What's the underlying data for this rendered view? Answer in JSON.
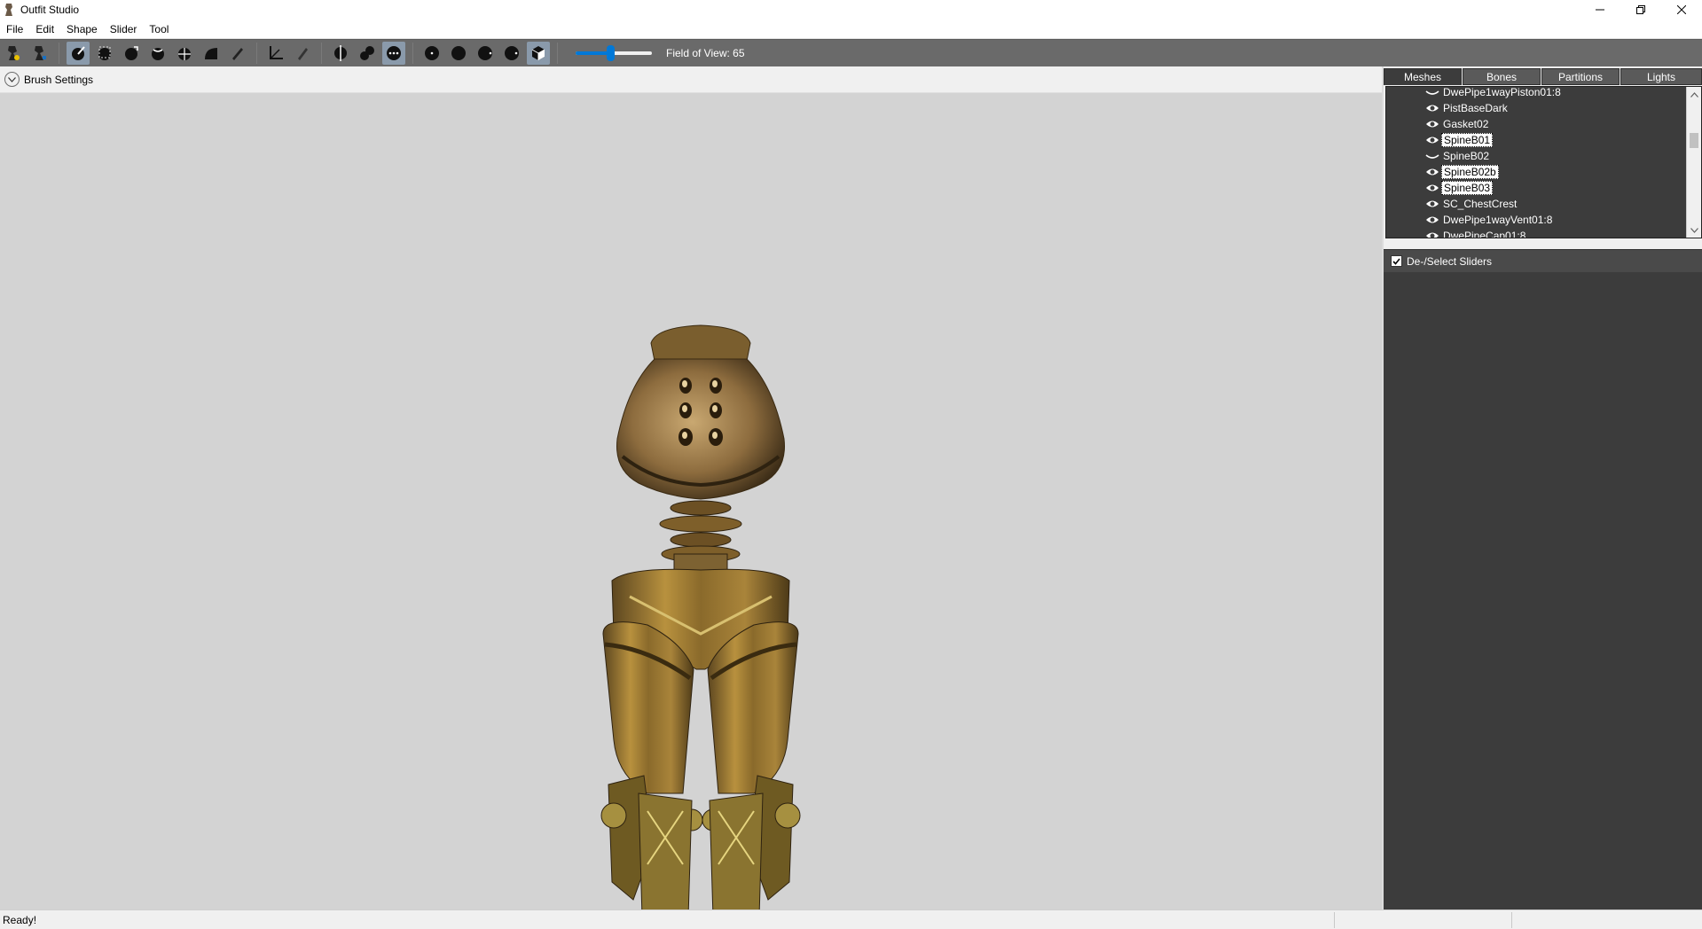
{
  "window": {
    "title": "Outfit Studio"
  },
  "menu": [
    "File",
    "Edit",
    "Shape",
    "Slider",
    "Tool"
  ],
  "toolbar": {
    "fov_label": "Field of View: 65",
    "fov_value": 65
  },
  "brush_settings": {
    "label": "Brush Settings"
  },
  "tabs": [
    {
      "label": "Meshes",
      "selected": true
    },
    {
      "label": "Bones",
      "selected": false
    },
    {
      "label": "Partitions",
      "selected": false
    },
    {
      "label": "Lights",
      "selected": false
    }
  ],
  "meshes": [
    {
      "name": "DwePipe1wayPiston01:8",
      "visible": false,
      "selected": false
    },
    {
      "name": "PistBaseDark",
      "visible": true,
      "selected": false
    },
    {
      "name": "Gasket02",
      "visible": true,
      "selected": false
    },
    {
      "name": "SpineB01",
      "visible": true,
      "selected": true
    },
    {
      "name": "SpineB02",
      "visible": false,
      "selected": false
    },
    {
      "name": "SpineB02b",
      "visible": true,
      "selected": true
    },
    {
      "name": "SpineB03",
      "visible": true,
      "selected": true
    },
    {
      "name": "SC_ChestCrest",
      "visible": true,
      "selected": false
    },
    {
      "name": "DwePipe1wayVent01:8",
      "visible": true,
      "selected": false
    },
    {
      "name": "DwePipeCap01:8",
      "visible": true,
      "selected": false
    }
  ],
  "sliders_header": {
    "label": "De-/Select Sliders",
    "checked": true
  },
  "status": {
    "text": "Ready!"
  },
  "colors": {
    "toolbar": "#6a6a6a",
    "viewport": "#d3d3d3",
    "panel_dark": "#3c3c3c",
    "accent": "#0078d7"
  }
}
